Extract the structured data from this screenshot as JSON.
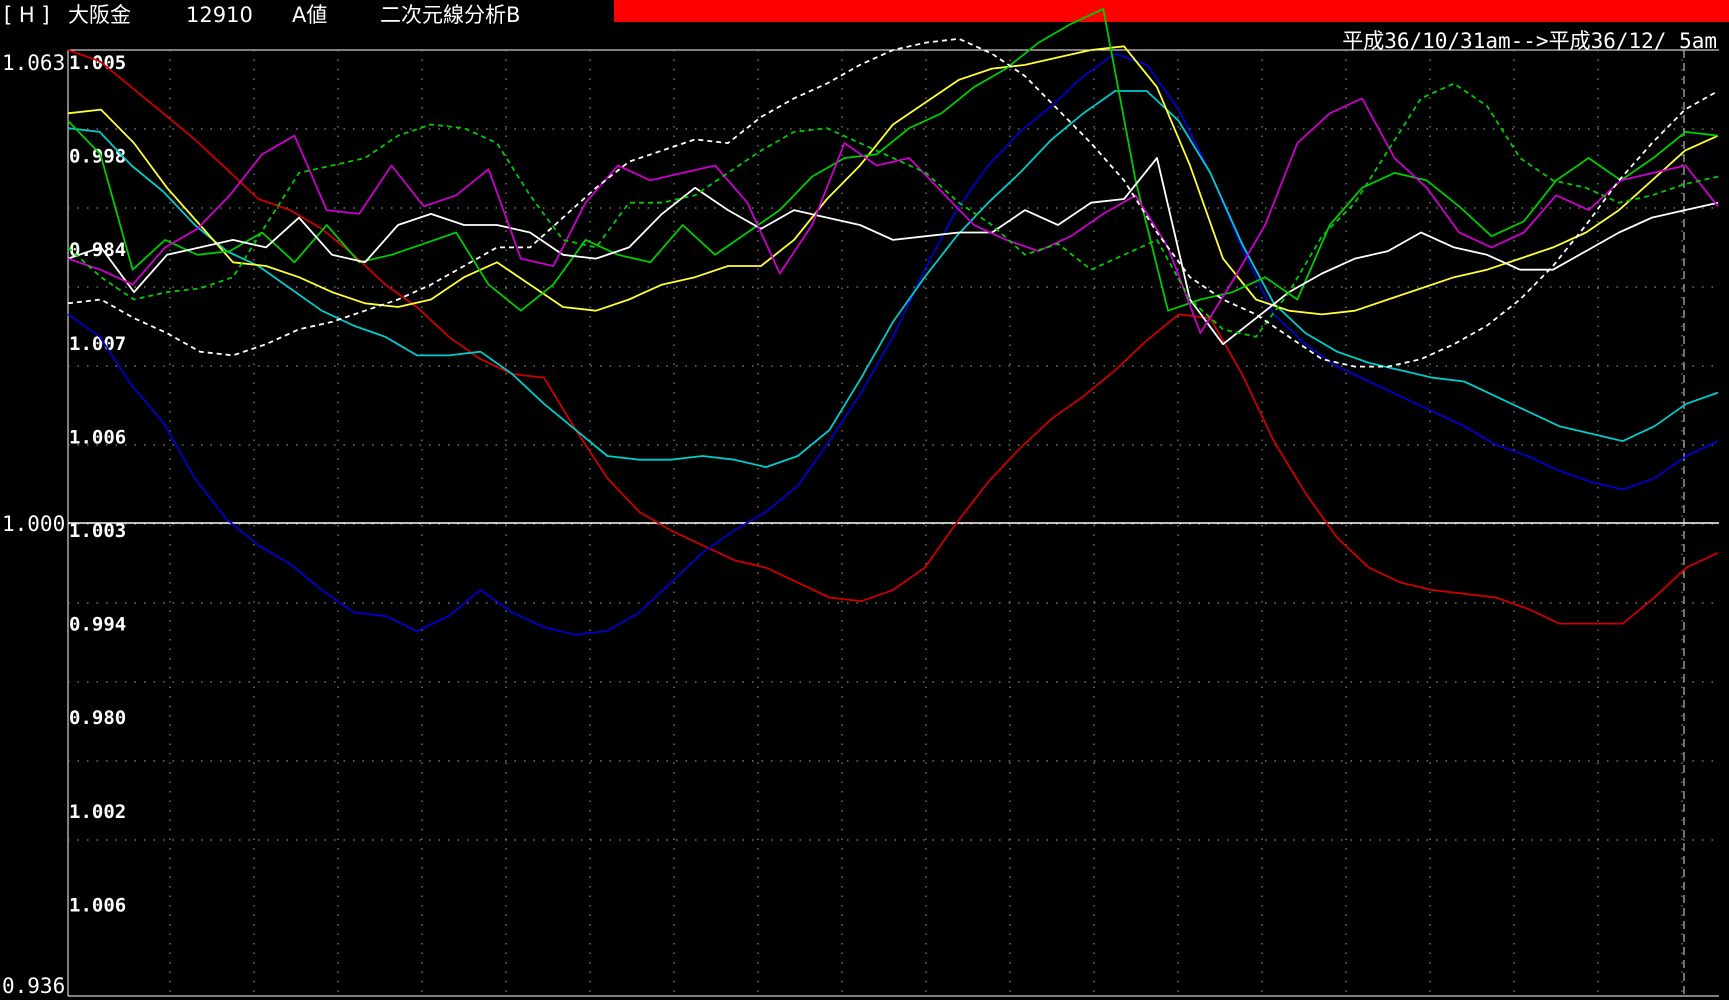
{
  "header": {
    "bracket_label": "[ H ]",
    "instrument": "大阪金",
    "code": "12910",
    "value_type": "A値",
    "analysis": "二次元線分析B",
    "bar_color": "#ff0000"
  },
  "date_range": "平成36/10/31am-->平成36/12/ 5am",
  "chart_data": {
    "type": "line",
    "ylim": [
      0.936,
      1.063
    ],
    "y_axis_labels": {
      "top": "1.063",
      "middle": "1.000",
      "bottom": "0.936"
    },
    "row_labels": [
      "1.005",
      "0.998",
      "0.984",
      "1.007",
      "1.006",
      "1.003",
      "0.994",
      "0.980",
      "1.002",
      "1.006"
    ],
    "reference_value": 1.0,
    "grid": true,
    "x_count": 50,
    "series": [
      {
        "color": "#cc0000",
        "dashed": false,
        "values": [
          1.063,
          1.0615,
          1.058,
          1.0545,
          1.051,
          1.047,
          1.043,
          1.0415,
          1.039,
          1.0355,
          1.0315,
          1.0285,
          1.0245,
          1.0215,
          1.0195,
          1.019,
          1.012,
          1.0055,
          1.001,
          0.9985,
          0.9965,
          0.9945,
          0.9935,
          0.9915,
          0.9895,
          0.989,
          0.9905,
          0.9935,
          0.9995,
          1.005,
          1.0095,
          1.0135,
          1.0165,
          1.02,
          1.024,
          1.0275,
          1.027,
          1.0195,
          1.0105,
          1.0035,
          0.9975,
          0.9935,
          0.9915,
          0.9905,
          0.99,
          0.9895,
          0.988,
          0.986,
          0.986,
          0.986,
          0.9895,
          0.9935,
          0.9955
        ]
      },
      {
        "color": "#0000cc",
        "dashed": false,
        "values": [
          1.0275,
          1.0245,
          1.018,
          1.013,
          1.0055,
          1.0,
          0.9965,
          0.994,
          0.9905,
          0.9875,
          0.987,
          0.985,
          0.987,
          0.9905,
          0.9875,
          0.9855,
          0.9845,
          0.985,
          0.9875,
          0.9915,
          0.9955,
          0.9985,
          1.001,
          1.0045,
          1.0105,
          1.017,
          1.0245,
          1.0335,
          1.0415,
          1.0475,
          1.052,
          1.0555,
          1.0595,
          1.0625,
          1.061,
          1.055,
          1.0465,
          1.0365,
          1.0275,
          1.0235,
          1.0205,
          1.0185,
          1.0165,
          1.0145,
          1.0125,
          1.01,
          1.0085,
          1.0065,
          1.005,
          1.004,
          1.0055,
          1.0085,
          1.0105
        ]
      },
      {
        "color": "#00cccc",
        "dashed": false,
        "values": [
          1.0525,
          1.052,
          1.0475,
          1.044,
          1.0395,
          1.036,
          1.034,
          1.031,
          1.028,
          1.026,
          1.0245,
          1.022,
          1.022,
          1.0225,
          1.0195,
          1.0155,
          1.012,
          1.0085,
          1.008,
          1.008,
          1.0085,
          1.008,
          1.007,
          1.0085,
          1.012,
          1.019,
          1.0265,
          1.0325,
          1.038,
          1.0425,
          1.0465,
          1.051,
          1.0545,
          1.0575,
          1.0575,
          1.0535,
          1.0465,
          1.037,
          1.029,
          1.025,
          1.0225,
          1.021,
          1.02,
          1.019,
          1.0185,
          1.0165,
          1.0145,
          1.0125,
          1.0115,
          1.0105,
          1.0125,
          1.0155,
          1.017
        ]
      },
      {
        "color": "#ffff33",
        "dashed": false,
        "values": [
          1.0545,
          1.055,
          1.0505,
          1.0445,
          1.0395,
          1.0345,
          1.034,
          1.0325,
          1.0305,
          1.029,
          1.0285,
          1.0295,
          1.0325,
          1.0345,
          1.0315,
          1.0285,
          1.028,
          1.0295,
          1.0315,
          1.0325,
          1.034,
          1.034,
          1.0375,
          1.043,
          1.0475,
          1.053,
          1.056,
          1.059,
          1.0605,
          1.061,
          1.062,
          1.063,
          1.0635,
          1.058,
          1.0475,
          1.035,
          1.0295,
          1.028,
          1.0275,
          1.028,
          1.0295,
          1.031,
          1.0325,
          1.0335,
          1.035,
          1.0365,
          1.0385,
          1.0415,
          1.0455,
          1.0495,
          1.0515
        ]
      },
      {
        "color": "#00cc00",
        "dashed": false,
        "values": [
          1.0535,
          1.049,
          1.0335,
          1.0375,
          1.0355,
          1.036,
          1.0385,
          1.0345,
          1.0395,
          1.0345,
          1.0355,
          1.037,
          1.0385,
          1.0315,
          1.028,
          1.0315,
          1.0375,
          1.0355,
          1.0345,
          1.0395,
          1.0355,
          1.0385,
          1.0415,
          1.046,
          1.0485,
          1.049,
          1.0525,
          1.0545,
          1.058,
          1.0605,
          1.064,
          1.0665,
          1.0685,
          1.0455,
          1.028,
          1.0295,
          1.0305,
          1.0325,
          1.0295,
          1.0395,
          1.0445,
          1.0465,
          1.0455,
          1.042,
          1.038,
          1.04,
          1.0455,
          1.0485,
          1.0455,
          1.0485,
          1.052,
          1.0515
        ]
      },
      {
        "color": "#ffffff",
        "dashed": false,
        "values": [
          1.035,
          1.0365,
          1.0305,
          1.0355,
          1.0365,
          1.0375,
          1.0365,
          1.0405,
          1.0355,
          1.0345,
          1.0395,
          1.041,
          1.0395,
          1.0395,
          1.0385,
          1.0355,
          1.035,
          1.0365,
          1.041,
          1.0445,
          1.0415,
          1.039,
          1.0415,
          1.0405,
          1.0395,
          1.0375,
          1.038,
          1.0385,
          1.0385,
          1.0415,
          1.0395,
          1.0425,
          1.043,
          1.0485,
          1.0295,
          1.0235,
          1.027,
          1.0305,
          1.033,
          1.035,
          1.036,
          1.0385,
          1.0365,
          1.0355,
          1.0335,
          1.0335,
          1.036,
          1.0385,
          1.0405,
          1.0415,
          1.0425
        ]
      },
      {
        "color": "#cc00cc",
        "dashed": false,
        "values": [
          1.035,
          1.0335,
          1.0315,
          1.0365,
          1.039,
          1.0435,
          1.049,
          1.0515,
          1.0415,
          1.041,
          1.0475,
          1.042,
          1.0435,
          1.047,
          1.035,
          1.034,
          1.0425,
          1.0475,
          1.0455,
          1.0465,
          1.0475,
          1.0425,
          1.033,
          1.0395,
          1.0505,
          1.0475,
          1.0485,
          1.044,
          1.0395,
          1.0375,
          1.036,
          1.038,
          1.041,
          1.0435,
          1.0365,
          1.025,
          1.032,
          1.0395,
          1.0505,
          1.0545,
          1.0565,
          1.0485,
          1.0445,
          1.0385,
          1.0365,
          1.0385,
          1.0435,
          1.0415,
          1.0455,
          1.0465,
          1.0475,
          1.042
        ]
      },
      {
        "color": "#00cc00",
        "dashed": true,
        "values": [
          1.0365,
          1.0325,
          1.0295,
          1.0305,
          1.031,
          1.0325,
          1.0395,
          1.0465,
          1.0475,
          1.0485,
          1.0515,
          1.053,
          1.0525,
          1.0505,
          1.0435,
          1.0375,
          1.0365,
          1.0425,
          1.0425,
          1.0435,
          1.0465,
          1.0495,
          1.052,
          1.0525,
          1.0505,
          1.0485,
          1.0465,
          1.0425,
          1.0395,
          1.0355,
          1.037,
          1.0335,
          1.0355,
          1.0375,
          1.0295,
          1.0255,
          1.0245,
          1.0305,
          1.038,
          1.0425,
          1.0495,
          1.0565,
          1.0585,
          1.0555,
          1.0485,
          1.0455,
          1.0445,
          1.0425,
          1.0435,
          1.045,
          1.046
        ]
      },
      {
        "color": "#ffffff",
        "dashed": true,
        "values": [
          1.029,
          1.0295,
          1.027,
          1.025,
          1.0225,
          1.022,
          1.0235,
          1.0255,
          1.0265,
          1.028,
          1.0295,
          1.0315,
          1.034,
          1.0365,
          1.0365,
          1.0405,
          1.0445,
          1.048,
          1.0495,
          1.051,
          1.0505,
          1.054,
          1.0565,
          1.0585,
          1.061,
          1.063,
          1.064,
          1.0645,
          1.0625,
          1.0595,
          1.055,
          1.0505,
          1.0455,
          1.0385,
          1.0325,
          1.0295,
          1.0275,
          1.0245,
          1.0215,
          1.0205,
          1.0205,
          1.0215,
          1.0235,
          1.026,
          1.0295,
          1.034,
          1.0395,
          1.0455,
          1.0505,
          1.055,
          1.0575
        ]
      }
    ]
  }
}
